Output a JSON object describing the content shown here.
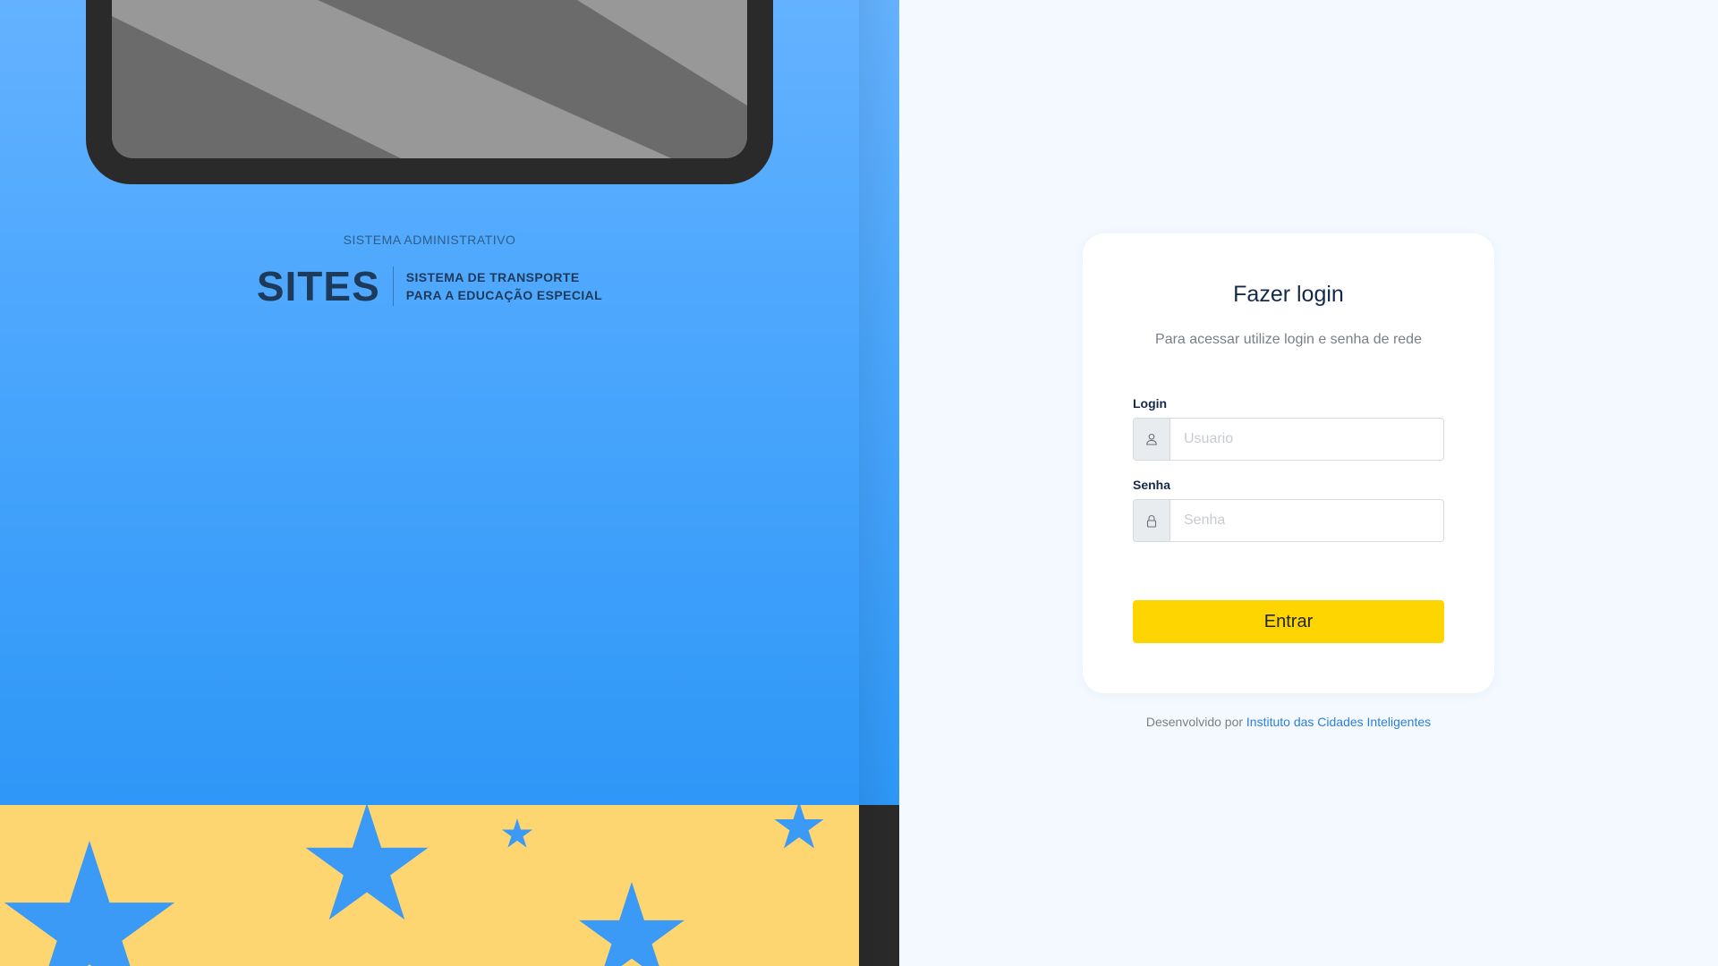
{
  "brand": {
    "kicker": "SISTEMA ADMINISTRATIVO",
    "name": "SITES",
    "subtitle_line1": "SISTEMA DE TRANSPORTE",
    "subtitle_line2": "PARA A EDUCAÇÃO ESPECIAL"
  },
  "login": {
    "title": "Fazer login",
    "subtitle": "Para acessar utilize login e senha de rede",
    "username_label": "Login",
    "username_placeholder": "Usuario",
    "username_icon": "user-icon",
    "password_label": "Senha",
    "password_placeholder": "Senha",
    "password_icon": "lock-icon",
    "submit_label": "Entrar"
  },
  "footer": {
    "prefix": "Desenvolvido por",
    "link_text": "Instituto das Cidades Inteligentes"
  },
  "colors": {
    "accent_yellow": "#ffd500",
    "panel_blue": "#4ca7fd",
    "band_yellow": "#fed671",
    "star_blue": "#3a9af5",
    "link_blue": "#2b7fd9",
    "page_background": "#f4f9ff"
  }
}
